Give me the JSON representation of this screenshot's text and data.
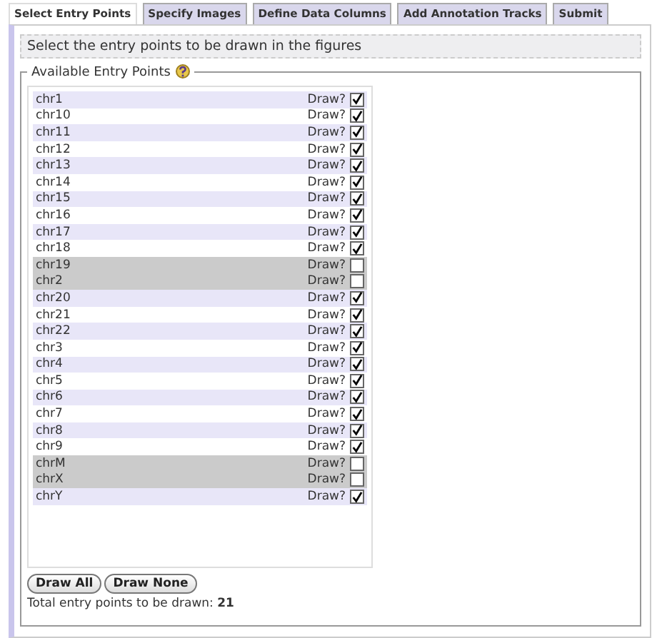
{
  "tabs": [
    {
      "label": "Select Entry Points",
      "selected": true
    },
    {
      "label": "Specify Images",
      "selected": false
    },
    {
      "label": "Define Data Columns",
      "selected": false
    },
    {
      "label": "Add Annotation Tracks",
      "selected": false
    },
    {
      "label": "Submit",
      "selected": false
    }
  ],
  "instruction": "Select the entry points to be drawn in the figures",
  "fieldset": {
    "legend": "Available Entry Points",
    "entries": [
      {
        "name": "chr1",
        "label": "Draw?",
        "checked": true
      },
      {
        "name": "chr10",
        "label": "Draw?",
        "checked": true
      },
      {
        "name": "chr11",
        "label": "Draw?",
        "checked": true
      },
      {
        "name": "chr12",
        "label": "Draw?",
        "checked": true
      },
      {
        "name": "chr13",
        "label": "Draw?",
        "checked": true
      },
      {
        "name": "chr14",
        "label": "Draw?",
        "checked": true
      },
      {
        "name": "chr15",
        "label": "Draw?",
        "checked": true
      },
      {
        "name": "chr16",
        "label": "Draw?",
        "checked": true
      },
      {
        "name": "chr17",
        "label": "Draw?",
        "checked": true
      },
      {
        "name": "chr18",
        "label": "Draw?",
        "checked": true
      },
      {
        "name": "chr19",
        "label": "Draw?",
        "checked": false
      },
      {
        "name": "chr2",
        "label": "Draw?",
        "checked": false
      },
      {
        "name": "chr20",
        "label": "Draw?",
        "checked": true
      },
      {
        "name": "chr21",
        "label": "Draw?",
        "checked": true
      },
      {
        "name": "chr22",
        "label": "Draw?",
        "checked": true
      },
      {
        "name": "chr3",
        "label": "Draw?",
        "checked": true
      },
      {
        "name": "chr4",
        "label": "Draw?",
        "checked": true
      },
      {
        "name": "chr5",
        "label": "Draw?",
        "checked": true
      },
      {
        "name": "chr6",
        "label": "Draw?",
        "checked": true
      },
      {
        "name": "chr7",
        "label": "Draw?",
        "checked": true
      },
      {
        "name": "chr8",
        "label": "Draw?",
        "checked": true
      },
      {
        "name": "chr9",
        "label": "Draw?",
        "checked": true
      },
      {
        "name": "chrM",
        "label": "Draw?",
        "checked": false
      },
      {
        "name": "chrX",
        "label": "Draw?",
        "checked": false
      },
      {
        "name": "chrY",
        "label": "Draw?",
        "checked": true
      }
    ],
    "buttons": [
      "Draw All",
      "Draw None"
    ],
    "total": "Total entry points to be drawn: **21**"
  }
}
